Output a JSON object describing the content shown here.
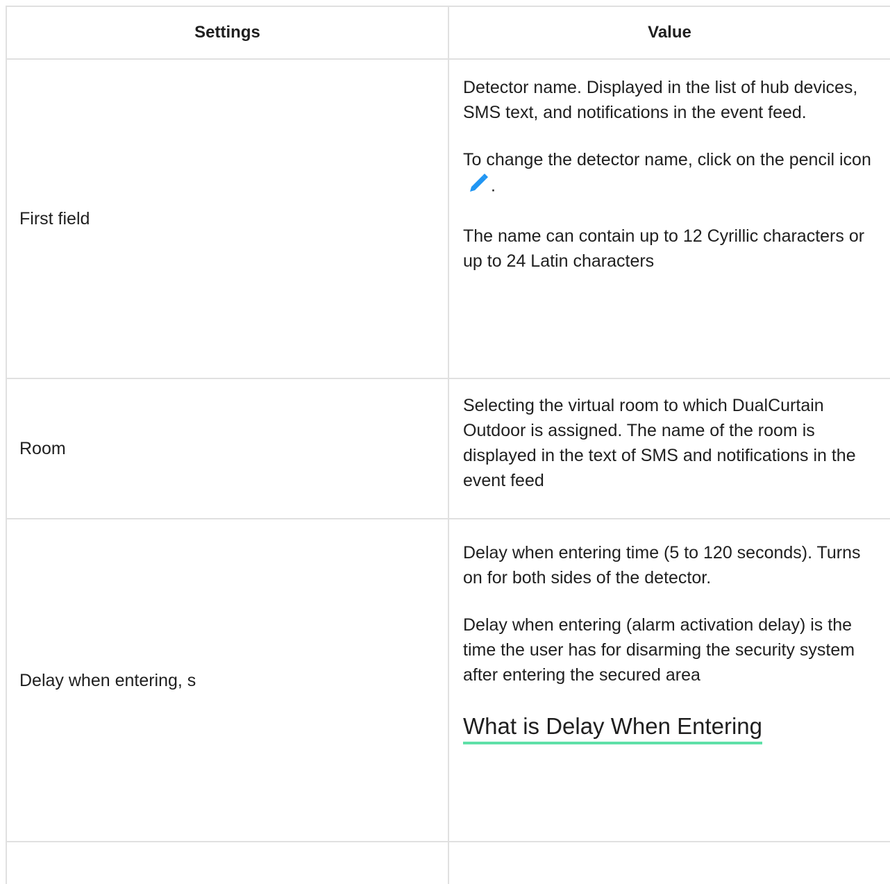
{
  "table": {
    "headers": {
      "settings": "Settings",
      "value": "Value"
    },
    "rows": [
      {
        "setting": "First field",
        "paragraphs": [
          "Detector name. Displayed in the list of hub devices, SMS text, and notifications in the event feed.",
          "To change the detector name, click on the pencil icon",
          "The name can contain up to 12 Cyrillic characters or up to 24 Latin characters"
        ],
        "pencil_suffix": "."
      },
      {
        "setting": "Room",
        "paragraphs": [
          "Selecting the virtual room to which DualCurtain Outdoor is assigned. The name of the room is displayed in the text of SMS and notifications in the event feed"
        ]
      },
      {
        "setting": "Delay when entering, s",
        "paragraphs": [
          "Delay when entering time (5 to 120 seconds). Turns on for both sides of the detector.",
          "Delay when entering (alarm activation delay) is the time the user has for disarming the security system after entering the secured area"
        ],
        "link": "What is Delay When Entering"
      },
      {
        "setting": "",
        "paragraphs": []
      }
    ]
  },
  "colors": {
    "border": "#e0e0e0",
    "pencil_icon": "#2196f3",
    "link_underline": "#5fe0a8"
  },
  "icons": {
    "pencil": "pencil-icon"
  }
}
